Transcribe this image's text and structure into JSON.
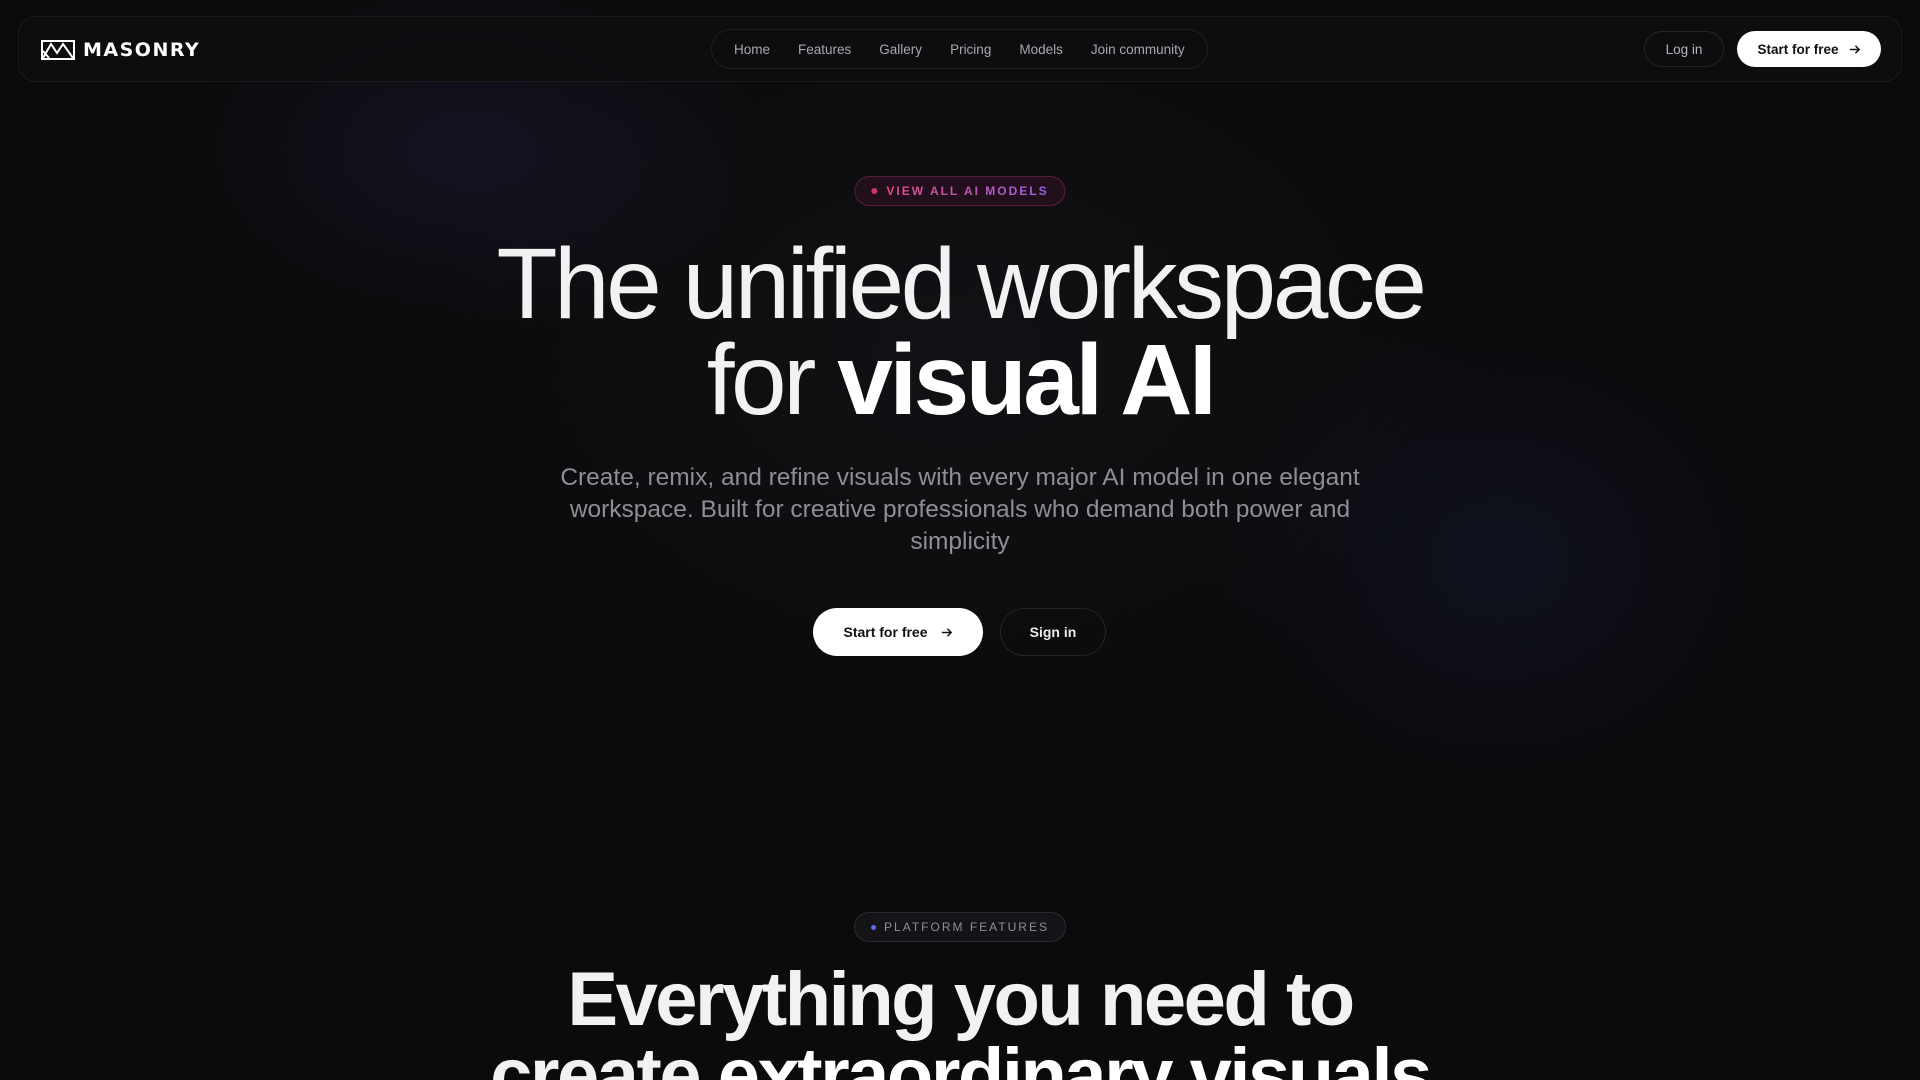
{
  "brand": {
    "name": "MASONRY"
  },
  "nav": {
    "links": [
      "Home",
      "Features",
      "Gallery",
      "Pricing",
      "Models",
      "Join community"
    ],
    "login_label": "Log in",
    "start_label": "Start for free"
  },
  "hero": {
    "badge": "VIEW ALL AI MODELS",
    "title_line1": "The unified workspace",
    "title_line2_light": "for ",
    "title_line2_bold": "visual AI",
    "subtitle": "Create, remix, and refine visuals with every major AI model in one elegant workspace. Built for creative professionals who demand both power and simplicity",
    "cta_start": "Start for free",
    "cta_signin": "Sign in"
  },
  "features": {
    "badge": "PLATFORM FEATURES",
    "title_line1": "Everything you need to",
    "title_line2_light": "create ",
    "title_line2_bold": "extraordinary visuals"
  },
  "colors": {
    "background": "#0b0b0c",
    "badge_pink": "#e24b84",
    "badge_purple": "#9b63e6",
    "badge_blue_dot": "#5a6cf0",
    "button_bg": "#ffffff"
  },
  "icons": {
    "logo": "mountain-logo-icon",
    "arrow": "arrow-right-icon"
  }
}
